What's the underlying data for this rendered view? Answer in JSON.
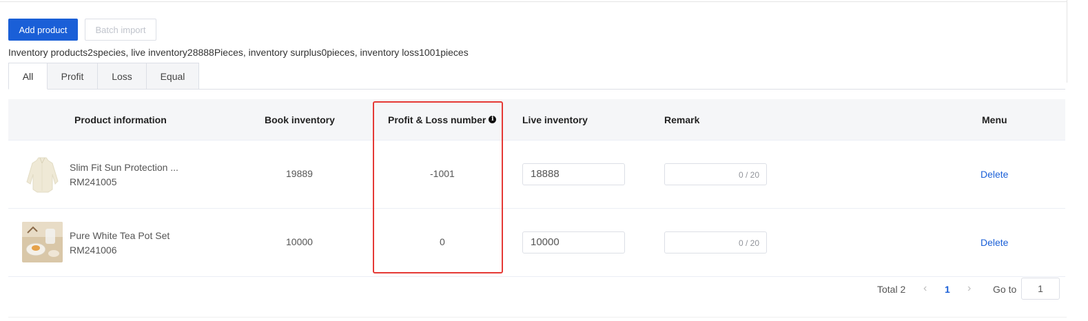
{
  "toolbar": {
    "add_label": "Add product",
    "import_label": "Batch import"
  },
  "summary": "Inventory products2species, live inventory28888Pieces, inventory surplus0pieces, inventory loss1001pieces",
  "tabs": [
    "All",
    "Profit",
    "Loss",
    "Equal"
  ],
  "table": {
    "headers": {
      "product": "Product information",
      "book": "Book inventory",
      "pl": "Profit & Loss number",
      "live": "Live inventory",
      "remark": "Remark",
      "menu": "Menu"
    },
    "rows": [
      {
        "name": "Slim Fit Sun Protection ...",
        "code": "RM241005",
        "book": "19889",
        "pl": "-1001",
        "live": "18888",
        "remark_count": "0 / 20",
        "action": "Delete"
      },
      {
        "name": "Pure White Tea Pot Set",
        "code": "RM241006",
        "book": "10000",
        "pl": "0",
        "live": "10000",
        "remark_count": "0 / 20",
        "action": "Delete"
      }
    ]
  },
  "pagination": {
    "total": "Total 2",
    "current": "1",
    "goto_label": "Go to",
    "goto_value": "1"
  },
  "icons": {
    "info": "info-icon",
    "prev": "chevron-left-icon",
    "next": "chevron-right-icon"
  },
  "colors": {
    "primary": "#1a5fd7",
    "highlight": "#e53935"
  }
}
